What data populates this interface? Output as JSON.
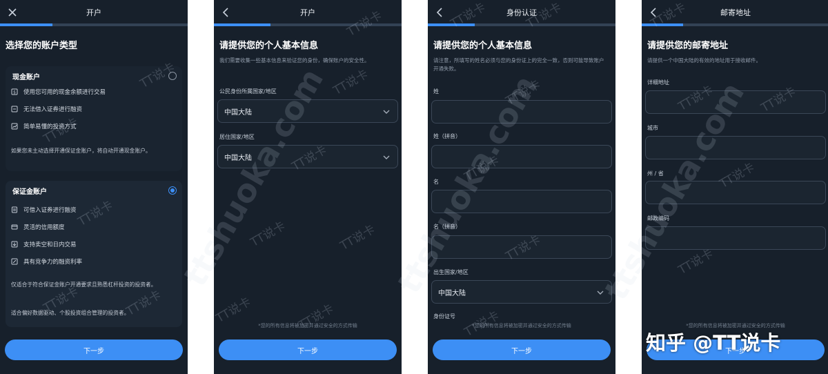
{
  "screens": [
    {
      "title": "开户",
      "heading": "选择您的账户类型",
      "cash_account": {
        "title": "现金账户",
        "features": [
          "使用您可用的现金余额进行交易",
          "无法借入证券进行融资",
          "简单易懂的投资方式"
        ],
        "note": "如果您未主动选择开通保证金账户，将自动开通现金账户。"
      },
      "margin_account": {
        "title": "保证金账户",
        "features": [
          "可借入证券进行融资",
          "灵活的信用额度",
          "支持卖空和日内交易",
          "具有竞争力的融资利率"
        ],
        "note1": "仅适合于符合保证金账户开通要求且熟悉杠杆投资的投资者。",
        "note2": "适合偏好数据驱动、个股投资组合管理的投资者。"
      },
      "next_label": "下一步"
    },
    {
      "title": "开户",
      "heading": "请提供您的个人基本信息",
      "desc": "我们需要收集一些基本信息来验证您的身份，确保账户的安全性。",
      "fields": [
        {
          "label": "公民身份所属国家/地区",
          "value": "中国大陆"
        },
        {
          "label": "居住国家/地区",
          "value": "中国大陆"
        }
      ],
      "secure_note": "*您的所有信息将被加密并通过安全的方式传输",
      "next_label": "下一步"
    },
    {
      "title": "身份认证",
      "heading": "请提供您的个人基本信息",
      "desc": "请注意，所填写的姓名必须与您的身份证上的完全一致，否则可能导致账户开通失败。",
      "fields": [
        {
          "label": "姓",
          "value": ""
        },
        {
          "label": "姓（拼音）",
          "value": ""
        },
        {
          "label": "名",
          "value": ""
        },
        {
          "label": "名（拼音）",
          "value": ""
        },
        {
          "label": "出生国家/地区",
          "value": "中国大陆"
        }
      ],
      "cut_label": "身份证号",
      "secure_note": "*您的所有信息将被加密并通过安全的方式传输",
      "next_label": "下一步"
    },
    {
      "title": "邮寄地址",
      "heading": "请提供您的邮寄地址",
      "desc": "请提供一个中国大陆的有效的地址用于接收邮件。",
      "fields": [
        {
          "label": "详细地址",
          "value": ""
        },
        {
          "label": "城市",
          "value": ""
        },
        {
          "label": "州 / 省",
          "value": ""
        },
        {
          "label": "邮政编码",
          "value": ""
        }
      ],
      "secure_note": "*您的所有信息将被加密并通过安全的方式传输",
      "next_label": "下一步"
    }
  ],
  "watermarks": {
    "small": "TT说卡",
    "large": "ttshuoka.com",
    "corner": "知乎 @TT说卡"
  },
  "colors": {
    "accent": "#3d8ff5",
    "background": "#17202b",
    "field_border": "#3b4757"
  },
  "progress": [
    0.28,
    0.3,
    0.25,
    0.22
  ]
}
